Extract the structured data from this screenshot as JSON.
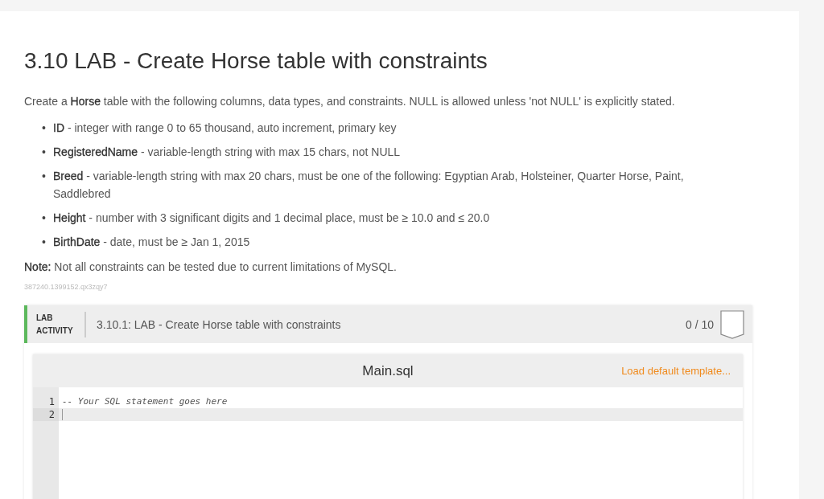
{
  "title": "3.10 LAB - Create Horse table with constraints",
  "intro": "Create a **Horse** table with the following columns, data types, and constraints. NULL is allowed unless 'not NULL' is explicitly stated.",
  "columns": [
    {
      "marker": "•",
      "text": "**ID** - integer with range 0 to 65 thousand, auto increment, primary key"
    },
    {
      "marker": "•",
      "text": "**RegisteredName** - variable-length string with max 15 chars, not NULL"
    },
    {
      "marker": "•",
      "text": "**Breed** - variable-length string with max 20 chars, must be one of the following: Egyptian Arab, Holsteiner, Quarter Horse, Paint, Saddlebred"
    },
    {
      "marker": "•",
      "text": "**Height** - number with 3 significant digits and 1 decimal place, must be ≥ 10.0 and ≤ 20.0"
    },
    {
      "marker": "•",
      "text": "**BirthDate** - date, must be ≥ Jan 1, 2015"
    }
  ],
  "note": "**Note:** Not all constraints can be tested due to current limitations of MySQL.",
  "content_id": "387240.1399152.qx3zqy7",
  "lab": {
    "label": "LAB ACTIVITY",
    "title": "3.10.1: LAB - Create Horse table with constraints",
    "score": "0 / 10",
    "editor": {
      "filename": "Main.sql",
      "load_template": "Load default template...",
      "lines": [
        {
          "number": "1",
          "code": "-- Your SQL statement goes here",
          "active": false
        },
        {
          "number": "2",
          "active": true
        }
      ]
    }
  }
}
